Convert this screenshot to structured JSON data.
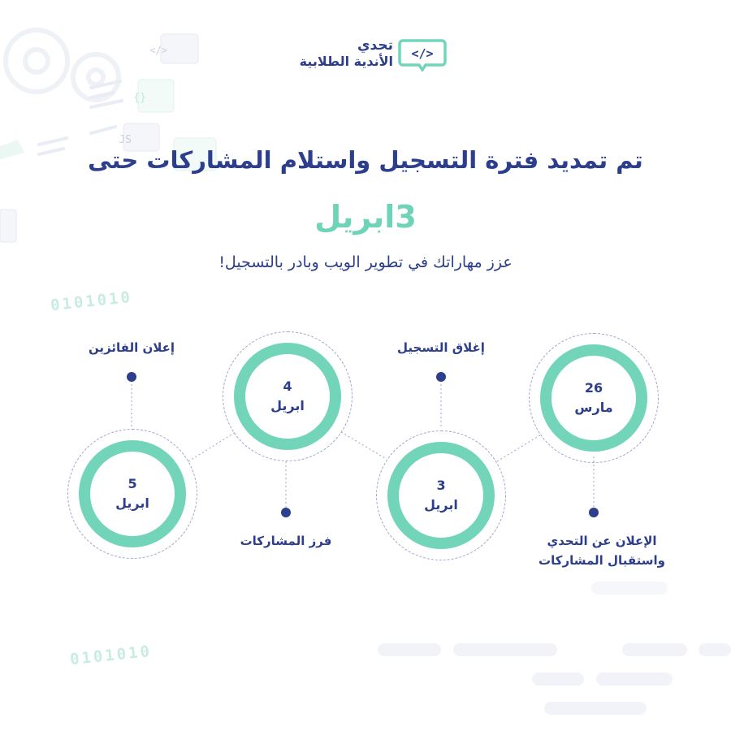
{
  "brand": {
    "line1": "تحدي",
    "line2": "الأندية الطلابية",
    "icon": "code-tag-icon",
    "icon_text": "</>",
    "color_primary": "#2c3e8c",
    "color_accent": "#72d5b9"
  },
  "headline": "تم تمديد فترة التسجيل واستلام المشاركات حتى",
  "highlight_date": "3ابريل",
  "subline": "عزز مهاراتك في تطوير الويب وبادر بالتسجيل!",
  "decorations": {
    "binary_1": "0101010",
    "binary_2": "0101010",
    "code_icon": "</>",
    "braces_icon": "{}",
    "js_icon": "JS"
  },
  "timeline": [
    {
      "day": "26",
      "month": "مارس",
      "label": "الإعلان عن التحدي\nواستقبال المشاركات"
    },
    {
      "day": "3",
      "month": "ابريل",
      "label": "إغلاق التسجيل"
    },
    {
      "day": "4",
      "month": "ابريل",
      "label": "فرز المشاركات"
    },
    {
      "day": "5",
      "month": "ابريل",
      "label": "إعلان الفائزين"
    }
  ]
}
